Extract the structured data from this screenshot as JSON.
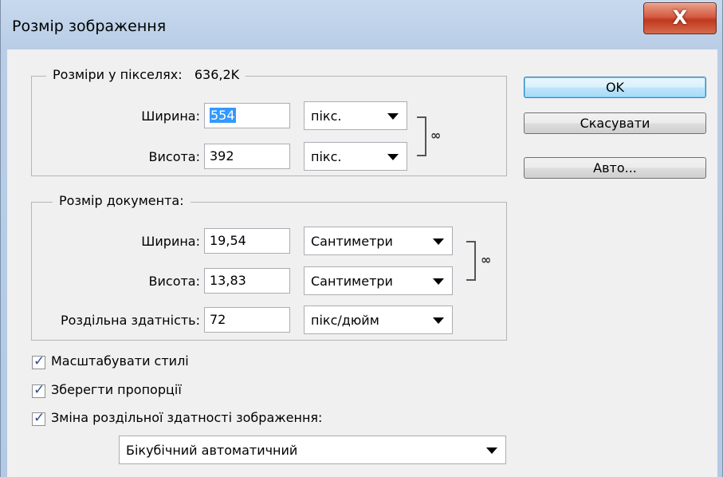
{
  "window": {
    "title": "Розмір зображення",
    "close_glyph": "X"
  },
  "pixel_dimensions": {
    "legend": "Розміри у пікселях:",
    "size": "636,2K",
    "width_label": "Ширина:",
    "width_value": "554",
    "width_unit": "пікс.",
    "height_label": "Висота:",
    "height_value": "392",
    "height_unit": "пікс."
  },
  "document_size": {
    "legend": "Розмір документа:",
    "width_label": "Ширина:",
    "width_value": "19,54",
    "width_unit": "Сантиметри",
    "height_label": "Висота:",
    "height_value": "13,83",
    "height_unit": "Сантиметри",
    "resolution_label": "Роздільна здатність:",
    "resolution_value": "72",
    "resolution_unit": "пікс/дюйм"
  },
  "buttons": {
    "ok": "OK",
    "cancel": "Скасувати",
    "auto": "Авто..."
  },
  "options": {
    "scale_styles": {
      "label": "Масштабувати стилі",
      "checked": true
    },
    "constrain": {
      "label": "Зберегти пропорції",
      "checked": true
    },
    "resample": {
      "label": "Зміна роздільної здатності зображення:",
      "checked": true
    },
    "resample_method": "Бікубічний автоматичний"
  },
  "icons": {
    "link": "chain-link-icon",
    "check": "checkmark-icon",
    "dropdown": "chevron-down-icon"
  }
}
